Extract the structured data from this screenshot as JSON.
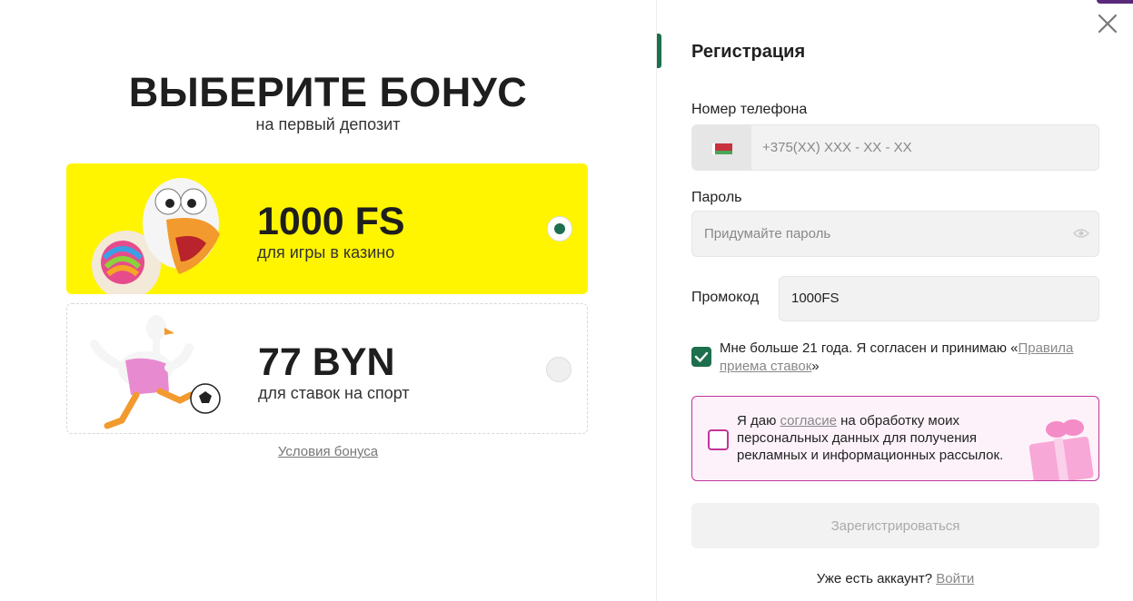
{
  "bonus": {
    "headline": "ВЫБЕРИТЕ БОНУС",
    "subline": "на первый депозит",
    "options": [
      {
        "amount": "1000 FS",
        "description": "для игры в казино",
        "selected": true
      },
      {
        "amount": "77 BYN",
        "description": "для ставок на спорт",
        "selected": false
      }
    ],
    "terms_link": "Условия бонуса"
  },
  "registration": {
    "title": "Регистрация",
    "phone": {
      "label": "Номер телефона",
      "placeholder": "+375(XX) XXX - XX - XX",
      "flag_icon": "belarus-flag-icon"
    },
    "password": {
      "label": "Пароль",
      "placeholder": "Придумайте пароль",
      "toggle_icon": "eye-icon"
    },
    "promo": {
      "label": "Промокод",
      "value": "1000FS"
    },
    "age_consent": {
      "text_before": "Мне больше 21 года. Я согласен и принимаю «",
      "link": "Правила приема ставок",
      "text_after": "»",
      "checked": true
    },
    "marketing_consent": {
      "text_before": "Я даю ",
      "link": "согласие",
      "text_after": " на обработку моих персональных данных для получения рекламных и информационных рассылок.",
      "checked": false
    },
    "submit_label": "Зарегистрироваться",
    "login_prompt": "Уже есть аккаунт?",
    "login_link": "Войти"
  },
  "colors": {
    "accent": "#1e6f4d",
    "bonus_highlight": "#fff500",
    "consent_border": "#c0359a"
  }
}
